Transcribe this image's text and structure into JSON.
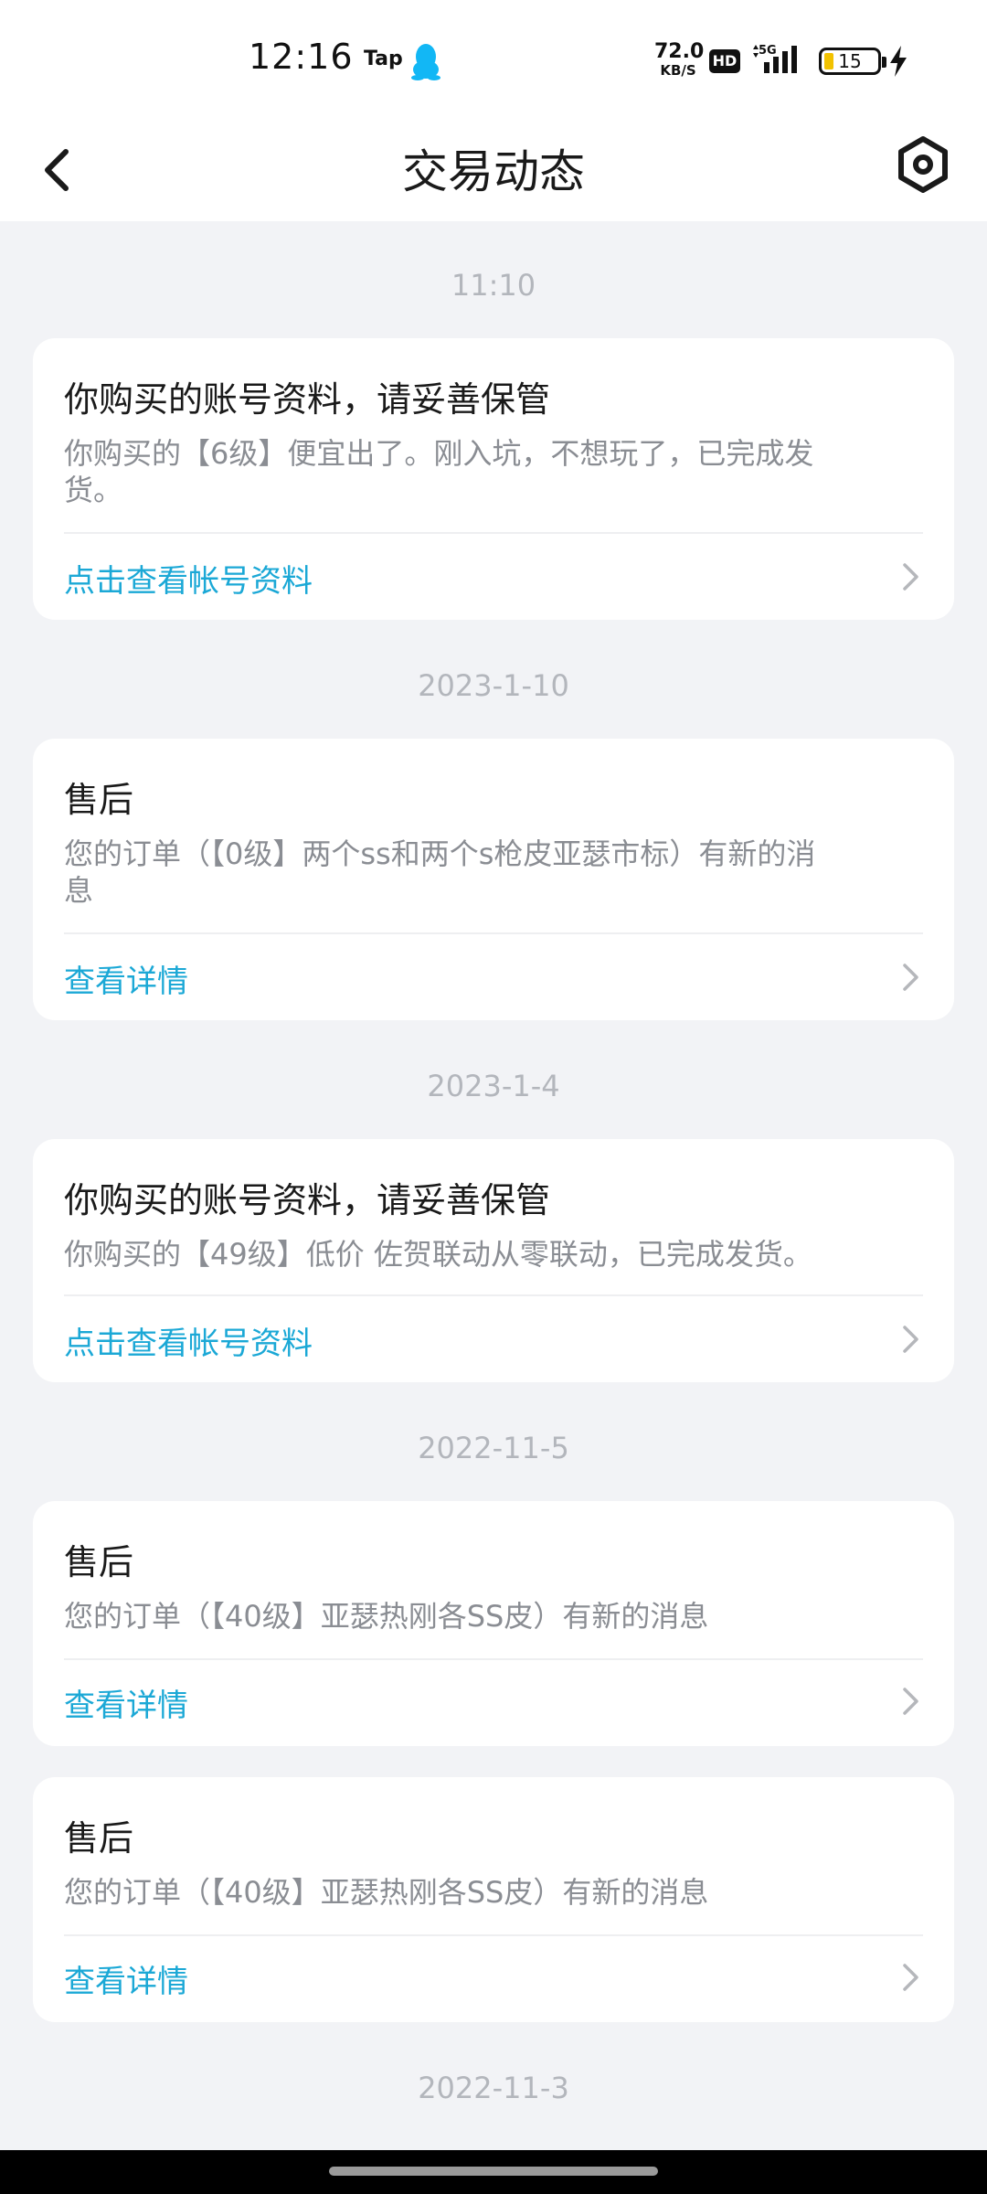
{
  "status_bar": {
    "time": "12:16",
    "tap_label": "Tap",
    "net_speed": "72.0",
    "net_unit": "KB/S",
    "hd_badge": "HD",
    "network": "5G",
    "battery_level": "15",
    "battery_color": "#f2c200"
  },
  "nav": {
    "title": "交易动态",
    "back_icon": "chevron-left-icon",
    "settings_icon": "hexagon-settings-icon"
  },
  "accent_color": "#1ba8d6",
  "feed": [
    {
      "date": "11:10",
      "title": "你购买的账号资料，请妥善保管",
      "desc_line1": "你购买的【6级】便宜出了。刚入坑，不想玩了，已完成发",
      "desc_line2": "货。",
      "link": "点击查看帐号资料"
    },
    {
      "date": "2023-1-10",
      "title": "售后",
      "desc_line1": "您的订单（【0级】两个ss和两个s枪皮亚瑟市标）有新的消",
      "desc_line2": "息",
      "link": "查看详情"
    },
    {
      "date": "2023-1-4",
      "title": "你购买的账号资料，请妥善保管",
      "desc_line1": "你购买的【49级】低价 佐贺联动从零联动，已完成发货。",
      "link": "点击查看帐号资料"
    },
    {
      "date": "2022-11-5",
      "title": "售后",
      "desc_line1": "您的订单（【40级】亚瑟热刚各SS皮）有新的消息",
      "link": "查看详情"
    },
    {
      "title": "售后",
      "desc_line1": "您的订单（【40级】亚瑟热刚各SS皮）有新的消息",
      "link": "查看详情"
    },
    {
      "date": "2022-11-3"
    }
  ]
}
